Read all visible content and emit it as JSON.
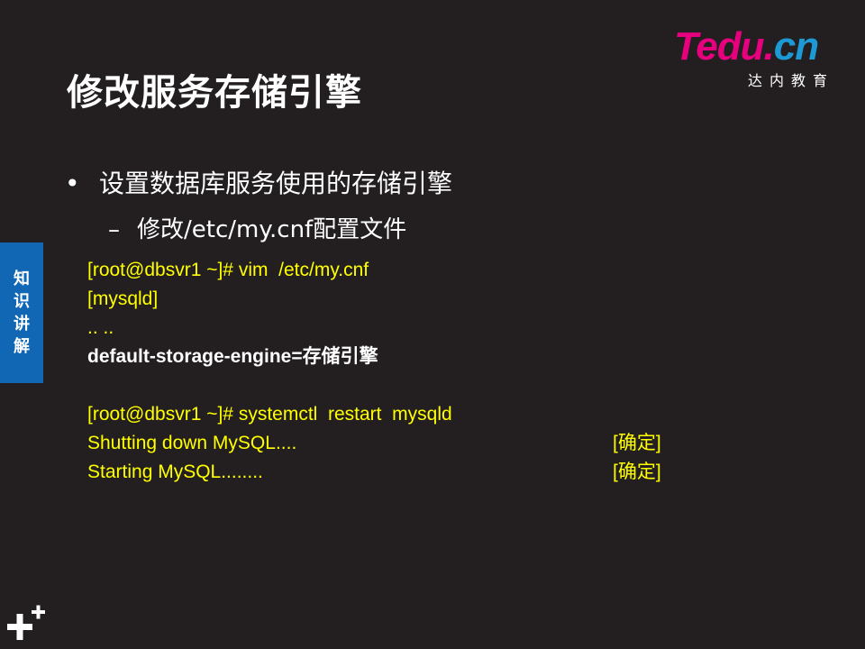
{
  "title": "修改服务存储引擎",
  "logo": {
    "brand_T": "T",
    "brand_edu": "edu",
    "brand_dot": ".",
    "brand_cn": "cn",
    "subtitle": "达内教育"
  },
  "side_tab": {
    "label": "知识讲解"
  },
  "bullet": {
    "text": "设置数据库服务使用的存储引擎"
  },
  "sub_bullet": {
    "dash": "–",
    "text": "修改/etc/my.cnf配置文件"
  },
  "code": {
    "line1": "[root@dbsvr1 ~]# vim  /etc/my.cnf",
    "line2": "[mysqld]",
    "line3": ".. ..",
    "line4": "default-storage-engine=存储引擎",
    "line6": "[root@dbsvr1 ~]# systemctl  restart  mysqld",
    "line7": "Shutting down MySQL....",
    "line7_status": "[确定]",
    "line8": "Starting MySQL........",
    "line8_status": "[确定]"
  },
  "colors": {
    "background": "#231f20",
    "code_text": "#ffff00",
    "side_tab": "#1167b3",
    "logo_magenta": "#e6007e",
    "logo_blue": "#1d9ad6"
  }
}
